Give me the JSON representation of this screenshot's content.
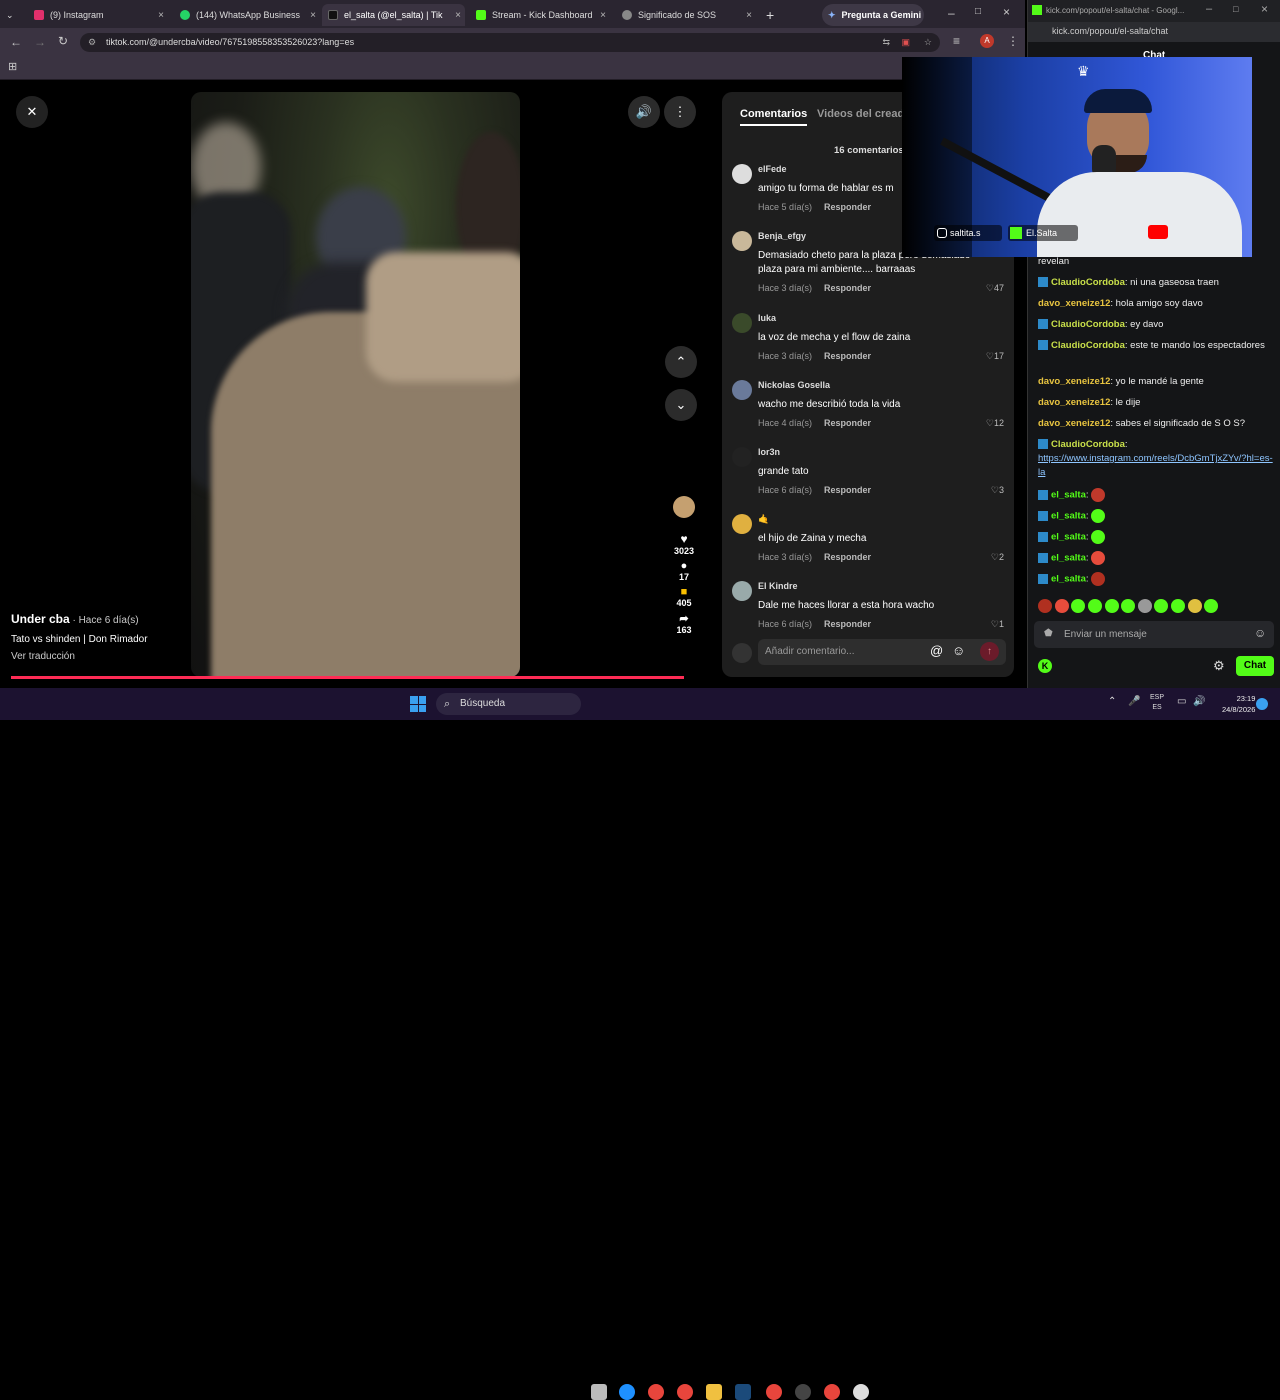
{
  "tabs": [
    {
      "label": "(9) Instagram",
      "color": "#e1306c"
    },
    {
      "label": "(144) WhatsApp Business",
      "color": "#25d366"
    },
    {
      "label": "el_salta (@el_salta) | Tik",
      "color": "#000000"
    },
    {
      "label": "Stream - Kick Dashboard",
      "color": "#53fc18"
    },
    {
      "label": "Significado de SOS",
      "color": "#888888"
    }
  ],
  "gemini_label": "Pregunta a Gemini",
  "url": "tiktok.com/@undercba/video/7675198558353526023?lang=es",
  "video": {
    "author": "Under cba",
    "time": "Hace 6 día(s)",
    "title": "Tato vs shinden | Don Rimador",
    "translate": "Ver traducción"
  },
  "rail": {
    "likes": "3023",
    "comments": "17",
    "saves": "405",
    "shares": "163"
  },
  "comments_panel": {
    "tab_comments": "Comentarios",
    "tab_videos": "Videos del creado",
    "count": "16 comentarios",
    "reply": "Responder",
    "input_placeholder": "Añadir comentario...",
    "items": [
      {
        "user": "elFede",
        "text": "amigo tu forma de hablar es m",
        "time": "Hace 5 día(s)",
        "likes": ""
      },
      {
        "user": "Benja_efgy",
        "text": "Demasiado cheto para la plaza pero demasiado plaza para mi ambiente.... barraaas",
        "time": "Hace 3 día(s)",
        "likes": "47"
      },
      {
        "user": "luka",
        "text": "la voz de mecha y el flow de zaina",
        "time": "Hace 3 día(s)",
        "likes": "17"
      },
      {
        "user": "Nickolas Gosella",
        "text": "wacho me describió toda la vida",
        "time": "Hace 4 día(s)",
        "likes": "12"
      },
      {
        "user": "lor3n",
        "text": "grande tato",
        "time": "Hace 6 día(s)",
        "likes": "3"
      },
      {
        "user": "🤙",
        "text": "el hijo de Zaina y mecha",
        "time": "Hace 3 día(s)",
        "likes": "2"
      },
      {
        "user": "El Kindre",
        "text": "Dale me haces llorar a esta hora wacho",
        "time": "Hace 6 día(s)",
        "likes": "1"
      }
    ]
  },
  "kick": {
    "title_url": "kick.com/popout/el-salta/chat - Googl...",
    "url": "kick.com/popout/el-salta/chat",
    "chat_header": "Chat",
    "cam_overlay": {
      "ig": "saltita.s",
      "kick": "El.Salta"
    },
    "lines": [
      {
        "user": "",
        "text": "revelan",
        "color": "#eeeeee",
        "badge": false
      },
      {
        "user": "ClaudioCordoba",
        "text": "ni una gaseosa traen",
        "color": "#c9e04a",
        "badge": true
      },
      {
        "user": "davo_xeneize12",
        "text": "hola amigo soy davo",
        "color": "#e8c440",
        "badge": false
      },
      {
        "user": "ClaudioCordoba",
        "text": "ey davo",
        "color": "#c9e04a",
        "badge": true
      },
      {
        "user": "ClaudioCordoba",
        "text": "este te mando los espectadores",
        "color": "#c9e04a",
        "badge": true
      },
      {
        "user": "davo_xeneize12",
        "text": "yo le mandé la gente",
        "color": "#e8c440",
        "badge": false
      },
      {
        "user": "davo_xeneize12",
        "text": "le dije",
        "color": "#e8c440",
        "badge": false
      },
      {
        "user": "davo_xeneize12",
        "text": "sabes el significado de S O S?",
        "color": "#e8c440",
        "badge": false
      },
      {
        "user": "ClaudioCordoba",
        "text": "",
        "color": "#c9e04a",
        "badge": true
      },
      {
        "user": "",
        "text": "https://www.instagram.com/reels/DcbGmTjxZYv/?hl=es-la",
        "color": "#eeeeee",
        "badge": false
      }
    ],
    "salta_user": "el_salta",
    "input_placeholder": "Enviar un mensaje",
    "chat_button": "Chat"
  },
  "taskbar": {
    "search": "Búsqueda",
    "lang": "ESP",
    "lang2": "ES",
    "time": "23:19",
    "date": "24/8/2026"
  }
}
